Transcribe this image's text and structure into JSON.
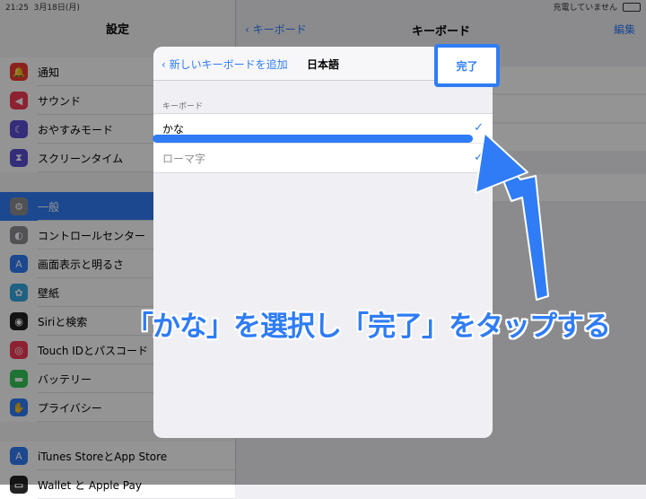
{
  "status": {
    "time": "21:25",
    "date": "3月18日(月)",
    "charging": "充電していません"
  },
  "sidebar": {
    "title": "設定",
    "groups": [
      [
        {
          "label": "通知",
          "icon": "bell-icon",
          "color": "#f13c33"
        },
        {
          "label": "サウンド",
          "icon": "speaker-icon",
          "color": "#f13c55"
        },
        {
          "label": "おやすみモード",
          "icon": "moon-icon",
          "color": "#5b4fd3"
        },
        {
          "label": "スクリーンタイム",
          "icon": "hourglass-icon",
          "color": "#5b4fd3"
        }
      ],
      [
        {
          "label": "一般",
          "icon": "gear-icon",
          "color": "#8e8e93",
          "selected": true
        },
        {
          "label": "コントロールセンター",
          "icon": "toggles-icon",
          "color": "#8e8e93"
        },
        {
          "label": "画面表示と明るさ",
          "icon": "text-size-icon",
          "color": "#2f7cf6"
        },
        {
          "label": "壁紙",
          "icon": "flower-icon",
          "color": "#35a8e0"
        },
        {
          "label": "Siriと検索",
          "icon": "siri-icon",
          "color": "#222"
        },
        {
          "label": "Touch IDとパスコード",
          "icon": "fingerprint-icon",
          "color": "#f13c55"
        },
        {
          "label": "バッテリー",
          "icon": "battery-icon",
          "color": "#34c759"
        },
        {
          "label": "プライバシー",
          "icon": "hand-icon",
          "color": "#2f7cf6"
        }
      ],
      [
        {
          "label": "iTunes StoreとApp Store",
          "icon": "app-store-icon",
          "color": "#2f7cf6"
        },
        {
          "label": "Wallet と Apple Pay",
          "icon": "wallet-icon",
          "color": "#222"
        }
      ]
    ]
  },
  "main": {
    "back": "キーボード",
    "title": "キーボード",
    "edit": "編集"
  },
  "modal": {
    "back": "新しいキーボードを追加",
    "title": "日本語",
    "done": "完了",
    "section_header": "キーボード",
    "rows": [
      {
        "label": "かな",
        "checked": true
      },
      {
        "label": "ローマ字",
        "checked": true
      }
    ]
  },
  "annotation": {
    "caption": "「かな」を選択し「完了」をタップする",
    "color": "#2f7cf6"
  }
}
